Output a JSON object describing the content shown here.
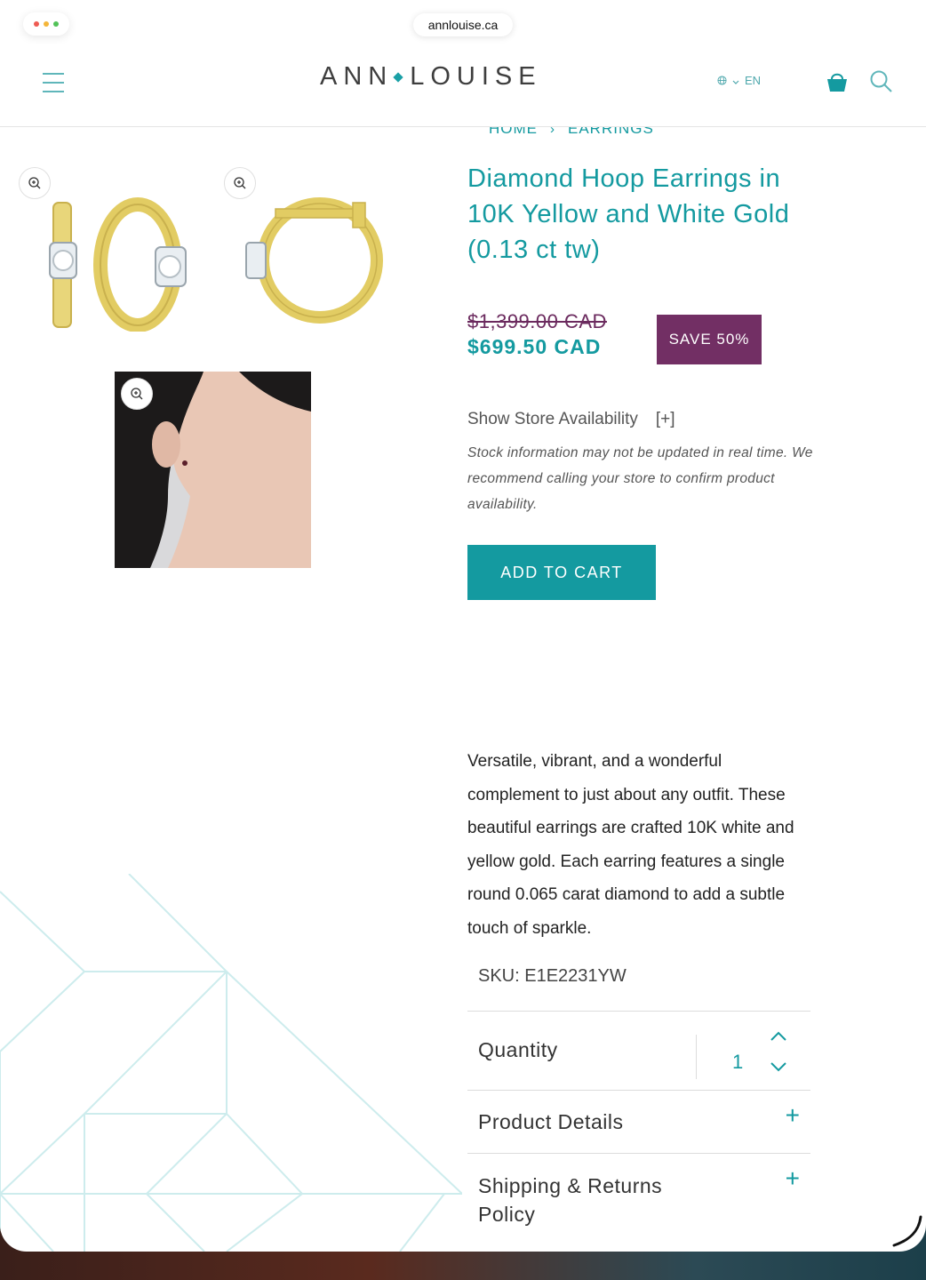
{
  "browser": {
    "url": "annlouise.ca"
  },
  "header": {
    "logo_left": "ANN",
    "logo_right": "LOUISE",
    "language": "EN"
  },
  "breadcrumb": {
    "home": "HOME",
    "separator": "›",
    "current": "EARRINGS"
  },
  "product": {
    "title": "Diamond Hoop Earrings in 10K Yellow and White Gold (0.13 ct tw)",
    "original_price": "$1,399.00 CAD",
    "sale_price": "$699.50 CAD",
    "save_badge": "SAVE 50%",
    "store_availability_label": "Show Store Availability",
    "store_availability_toggle": "[+]",
    "stock_note": "Stock information may not be updated in real time. We recommend calling your store to confirm product availability.",
    "add_to_cart": "ADD TO CART",
    "description": "Versatile, vibrant, and a wonderful complement to just about any outfit. These beautiful earrings are crafted 10K white and yellow gold. Each earring features a single round 0.065 carat diamond to add a subtle touch of sparkle.",
    "sku": "SKU: E1E2231YW",
    "quantity_label": "Quantity",
    "quantity_value": "1",
    "product_details_label": "Product Details",
    "shipping_label": "Shipping & Returns Policy"
  },
  "colors": {
    "brand_teal": "#149aa0",
    "badge_purple": "#722f64",
    "strike_purple": "#6b2a5e"
  },
  "icons": [
    "menu-icon",
    "globe-icon",
    "chevron-down-icon",
    "shopping-bag-icon",
    "search-icon",
    "zoom-in-icon",
    "plus-icon",
    "chevron-up-icon"
  ]
}
